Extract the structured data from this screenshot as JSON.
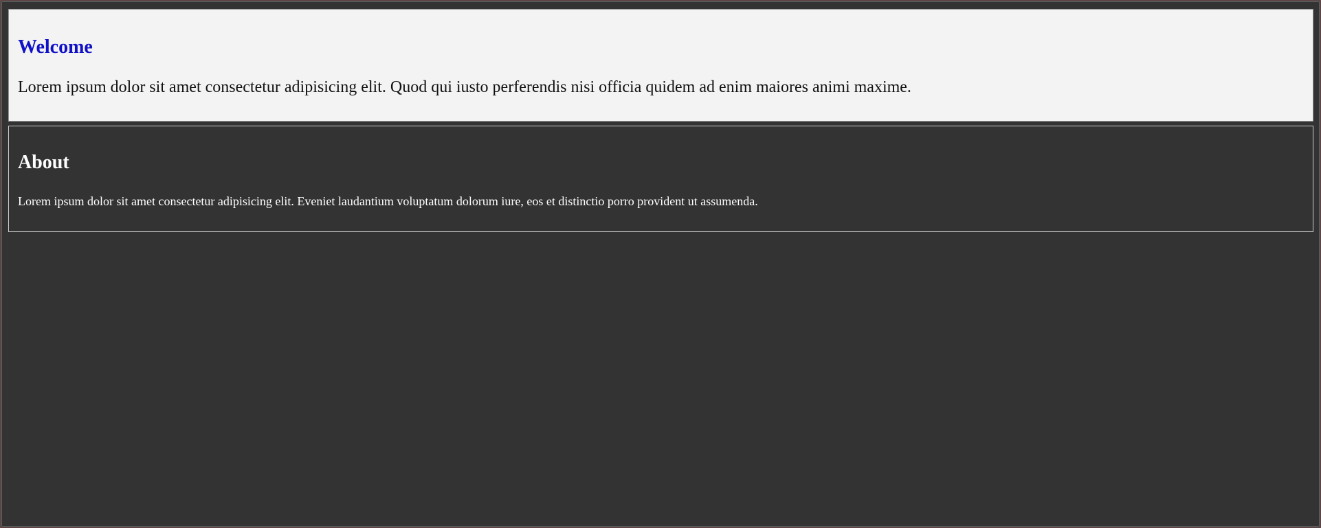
{
  "sections": {
    "welcome": {
      "title": "Welcome",
      "body": "Lorem ipsum dolor sit amet consectetur adipisicing elit. Quod qui iusto perferendis nisi officia quidem ad enim maiores animi maxime."
    },
    "about": {
      "title": "About",
      "body": "Lorem ipsum dolor sit amet consectetur adipisicing elit. Eveniet laudantium voluptatum dolorum iure, eos et distinctio porro provident ut assumenda."
    }
  },
  "colors": {
    "page_background": "#333333",
    "welcome_background": "#f3f3f3",
    "welcome_title": "#1010c8",
    "about_text": "#ffffff"
  }
}
